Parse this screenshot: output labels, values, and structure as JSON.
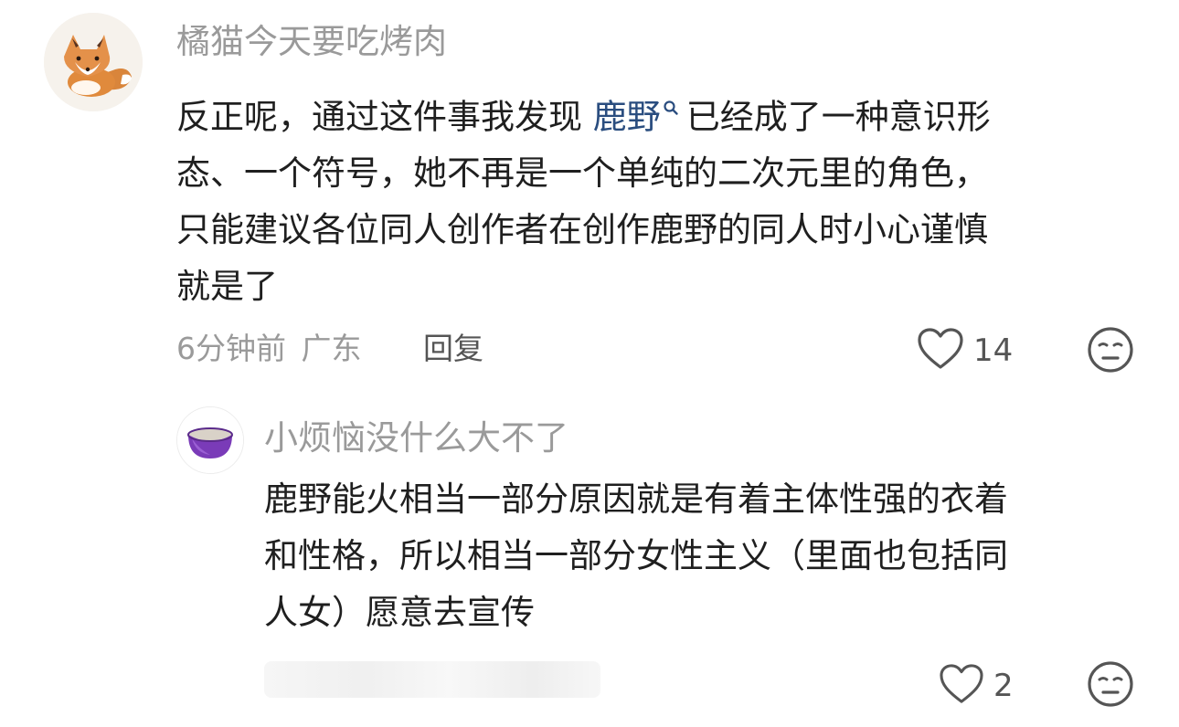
{
  "comments": [
    {
      "username": "橘猫今天要吃烤肉",
      "lines": [
        {
          "before": "反正呢，通过这件事我发现 ",
          "mention": "鹿野",
          "after": "已经成了一种意识形"
        },
        "态、一个符号，她不再是一个单纯的二次元里的角色，",
        "只能建议各位同人创作者在创作鹿野的同人时小心谨慎",
        "就是了"
      ],
      "time": "6分钟前",
      "location": "广东",
      "reply_label": "回复",
      "likes": "14",
      "avatar_icon": "fox-avatar-icon"
    },
    {
      "username": "小烦恼没什么大不了",
      "lines": [
        "鹿野能火相当一部分原因就是有着主体性强的衣着",
        "和性格，所以相当一部分女性主义（里面也包括同",
        "人女）愿意去宣传"
      ],
      "likes": "2",
      "avatar_icon": "purple-bowl-avatar-icon"
    }
  ],
  "colors": {
    "text": "#1f1f1f",
    "muted": "#9a9a9a",
    "mention": "#2a4d7f",
    "icon": "#555555"
  }
}
